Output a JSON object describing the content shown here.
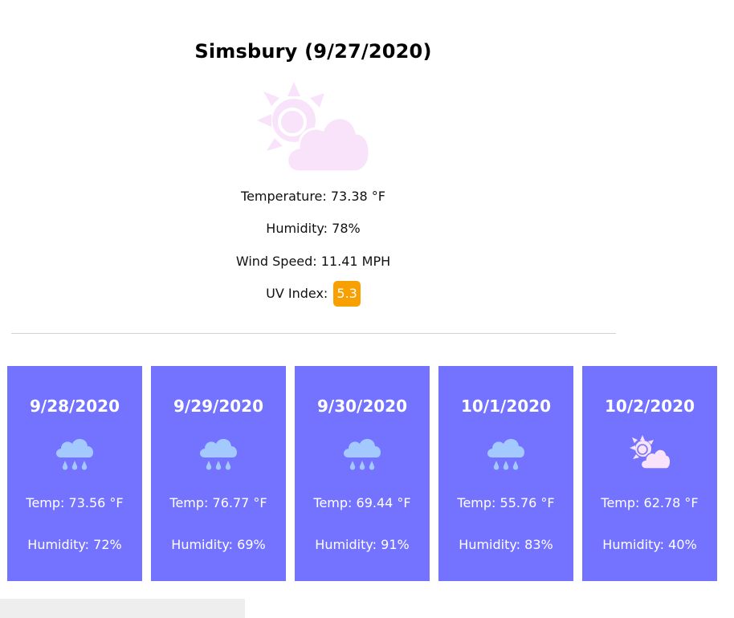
{
  "current": {
    "title": "Simsbury (9/27/2020)",
    "icon": "sun-behind-cloud-icon",
    "temperature_label": "Temperature:",
    "temperature_value": "73.38 °F",
    "humidity_label": "Humidity:",
    "humidity_value": "78%",
    "wind_label": "Wind Speed:",
    "wind_value": "11.41 MPH",
    "uv_label": "UV Index:",
    "uv_value": "5.3",
    "uv_color": "#f7a000"
  },
  "colors": {
    "card_background": "#7473ff",
    "icon_pink": "#f8e3fa",
    "icon_blue": "#a4c9ff"
  },
  "forecast": [
    {
      "date": "9/28/2020",
      "icon": "rain-cloud-icon",
      "temp": "Temp: 73.56 °F",
      "humidity": "Humidity: 72%"
    },
    {
      "date": "9/29/2020",
      "icon": "rain-cloud-icon",
      "temp": "Temp: 76.77 °F",
      "humidity": "Humidity: 69%"
    },
    {
      "date": "9/30/2020",
      "icon": "rain-cloud-icon",
      "temp": "Temp: 69.44 °F",
      "humidity": "Humidity: 91%"
    },
    {
      "date": "10/1/2020",
      "icon": "rain-cloud-icon",
      "temp": "Temp: 55.76 °F",
      "humidity": "Humidity: 83%"
    },
    {
      "date": "10/2/2020",
      "icon": "sun-behind-cloud-icon",
      "temp": "Temp: 62.78 °F",
      "humidity": "Humidity: 40%"
    }
  ]
}
